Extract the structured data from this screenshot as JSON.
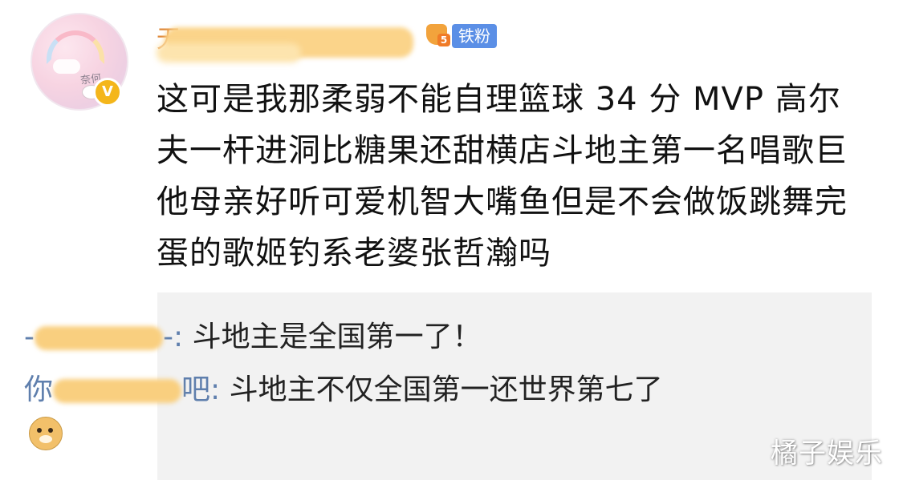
{
  "header": {
    "username_visible": "无",
    "fan_level": "5",
    "fan_badge_label": "铁粉",
    "verified_badge": "V"
  },
  "avatar": {
    "signature": "奈何"
  },
  "comment": {
    "text": "这可是我那柔弱不能自理篮球 34 分 MVP 高尔夫一杆进洞比糖果还甜横店斗地主第一名唱歌巨他母亲好听可爱机智大嘴鱼但是不会做饭跳舞完蛋的歌姬钓系老婆张哲瀚吗"
  },
  "replies": [
    {
      "user_prefix": "-",
      "user_suffix": "-:",
      "text": " 斗地主是全国第一了！"
    },
    {
      "user_prefix": "你",
      "user_suffix": "吧:",
      "text": " 斗地主不仅全国第一还世界第七了"
    }
  ],
  "watermark": "橘子娱乐",
  "colors": {
    "username_link": "#5f7fad",
    "fan_badge": "#5b8fe6",
    "verified": "#f4b61b",
    "reply_background": "#f2f2f2"
  },
  "icons": {
    "fan_medal": "fan-medal-icon",
    "doge_emoji": "doge-icon"
  }
}
